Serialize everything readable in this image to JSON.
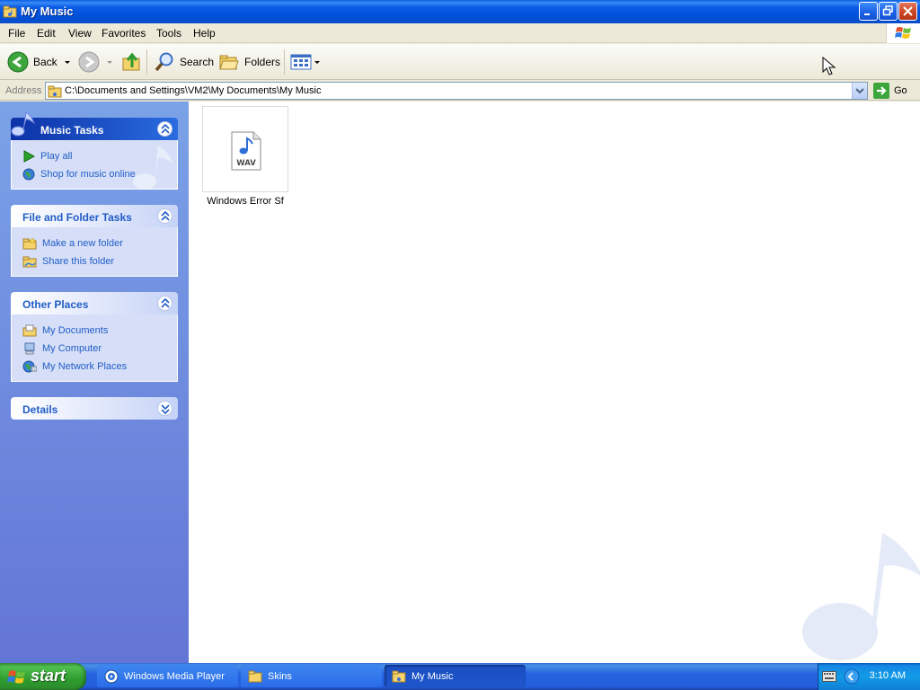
{
  "window": {
    "title": "My Music"
  },
  "menu": [
    "File",
    "Edit",
    "View",
    "Favorites",
    "Tools",
    "Help"
  ],
  "toolbar": {
    "back_label": "Back",
    "search_label": "Search",
    "folders_label": "Folders"
  },
  "address": {
    "label": "Address",
    "path": "C:\\Documents and Settings\\VM2\\My Documents\\My Music",
    "go_label": "Go"
  },
  "panels": {
    "music_tasks": {
      "title": "Music Tasks",
      "items": [
        "Play all",
        "Shop for music online"
      ]
    },
    "file_folder_tasks": {
      "title": "File and Folder Tasks",
      "items": [
        "Make a new folder",
        "Share this folder"
      ]
    },
    "other_places": {
      "title": "Other Places",
      "items": [
        "My Documents",
        "My Computer",
        "My Network Places"
      ]
    },
    "details": {
      "title": "Details"
    }
  },
  "files": [
    {
      "name": "Windows Error Sf",
      "badge": "WAV"
    }
  ],
  "taskbar": {
    "start_label": "start",
    "tasks": [
      "Windows Media Player",
      "Skins",
      "My Music"
    ],
    "clock": "3:10 AM"
  },
  "colors": {
    "accent_blue": "#215dc6",
    "title_blue": "#0050d8",
    "start_green": "#3c9a3c",
    "pane_blue": "#7ba2e7"
  }
}
